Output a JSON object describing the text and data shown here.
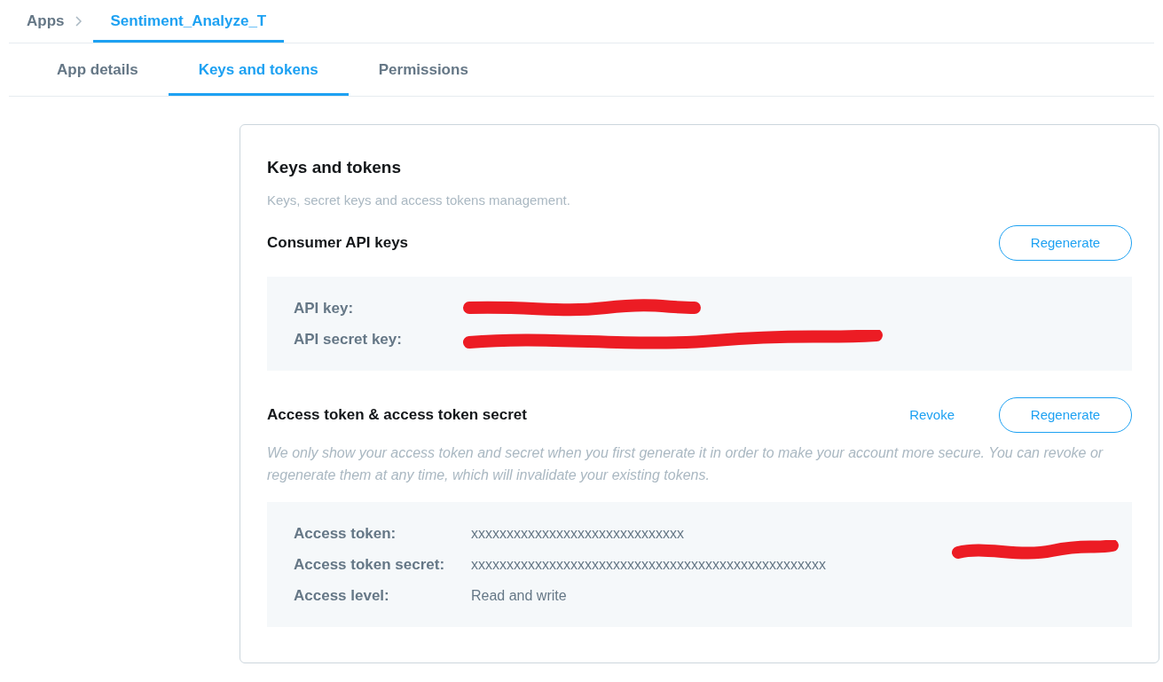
{
  "breadcrumb": [
    {
      "label": "Apps",
      "selected": false
    },
    {
      "label": "Sentiment_Analyze_T",
      "selected": true
    }
  ],
  "tabs": [
    {
      "label": "App details",
      "selected": false
    },
    {
      "label": "Keys and tokens",
      "selected": true
    },
    {
      "label": "Permissions",
      "selected": false
    }
  ],
  "card": {
    "title": "Keys and tokens",
    "subtitle": "Keys, secret keys and access tokens management.",
    "sections": [
      {
        "title": "Consumer API keys",
        "actions": [
          {
            "label": "Regenerate",
            "kind": "outline"
          }
        ],
        "redacted": false,
        "rows": [
          {
            "label": "API key:",
            "redacted": true
          },
          {
            "label": "API secret key:",
            "redacted": true
          }
        ]
      },
      {
        "title": "Access token & access token secret",
        "actions": [
          {
            "label": "Revoke",
            "kind": "link"
          },
          {
            "label": "Regenerate",
            "kind": "outline"
          }
        ],
        "note": "We only show your access token and secret when you first generate it in order to make your account more secure. You can revoke or regenerate them at any time, which will invalidate your existing tokens.",
        "redacted": true,
        "rows": [
          {
            "label": "Access token:",
            "value": "xxxxxxxxxxxxxxxxxxxxxxxxxxxxxx",
            "redacted": false
          },
          {
            "label": "Access token secret:",
            "value": "xxxxxxxxxxxxxxxxxxxxxxxxxxxxxxxxxxxxxxxxxxxxxxxxxx",
            "redacted": false
          },
          {
            "label": "Access level:",
            "value": "Read and write",
            "redacted": false
          }
        ]
      }
    ]
  }
}
